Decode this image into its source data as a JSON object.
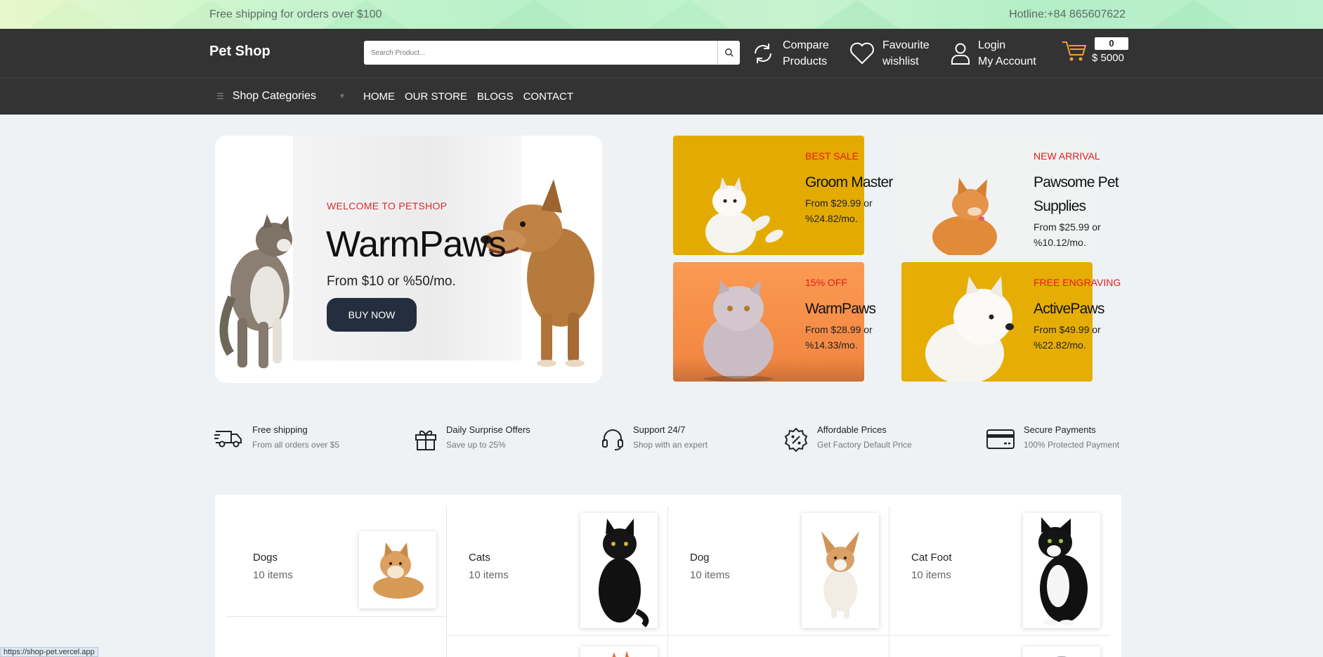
{
  "topbar": {
    "shipping_note": "Free shipping for orders over $100",
    "hotline": "Hotline:+84 865607622"
  },
  "header": {
    "logo": "Pet Shop",
    "search_placeholder": "Search Product...",
    "compare": [
      "Compare",
      "Products"
    ],
    "wishlist": [
      "Favourite",
      "wishlist"
    ],
    "account": [
      "Login",
      "My Account"
    ],
    "cart_count": "0",
    "cart_total": "$ 5000"
  },
  "nav": {
    "categories_label": "Shop Categories",
    "links": [
      "HOME",
      "OUR STORE",
      "BLOGS",
      "CONTACT"
    ]
  },
  "hero": {
    "pretitle": "WELCOME TO PETSHOP",
    "title": "WarmPaws",
    "subtitle": "From $10 or %50/mo.",
    "button": "BUY NOW"
  },
  "promos": [
    {
      "tag": "BEST SALE",
      "name": "Groom Master",
      "price": "From $29.99 or %24.82/mo.",
      "bg": "#e3ab00"
    },
    {
      "tag": "NEW ARRIVAL",
      "name": "Pawsome Pet Supplies",
      "price": "From $25.99 or %10.12/mo.",
      "bg": "#f1f3f3"
    },
    {
      "tag": "15% OFF",
      "name": "WarmPaws",
      "price": "From $28.99 or %14.33/mo.",
      "bg": "#f7934a"
    },
    {
      "tag": "FREE ENGRAVING",
      "name": "ActivePaws",
      "price": "From $49.99 or %22.82/mo.",
      "bg": "#e6ae05"
    }
  ],
  "services": [
    {
      "title": "Free shipping",
      "desc": "From all orders over $5",
      "icon": "truck-icon"
    },
    {
      "title": "Daily Surprise Offers",
      "desc": "Save up to 25%",
      "icon": "gift-icon"
    },
    {
      "title": "Support 24/7",
      "desc": "Shop with an expert",
      "icon": "headset-icon"
    },
    {
      "title": "Affordable Prices",
      "desc": "Get Factory Default Price",
      "icon": "percent-badge-icon"
    },
    {
      "title": "Secure Payments",
      "desc": "100% Protected Payment",
      "icon": "credit-card-icon"
    }
  ],
  "categories": [
    {
      "name": "Dogs",
      "items": "10 items"
    },
    {
      "name": "Cats",
      "items": "10 items"
    },
    {
      "name": "Dog",
      "items": "10 items"
    },
    {
      "name": "Cat Foot",
      "items": "10 items"
    }
  ],
  "status_url": "https://shop-pet.vercel.app"
}
